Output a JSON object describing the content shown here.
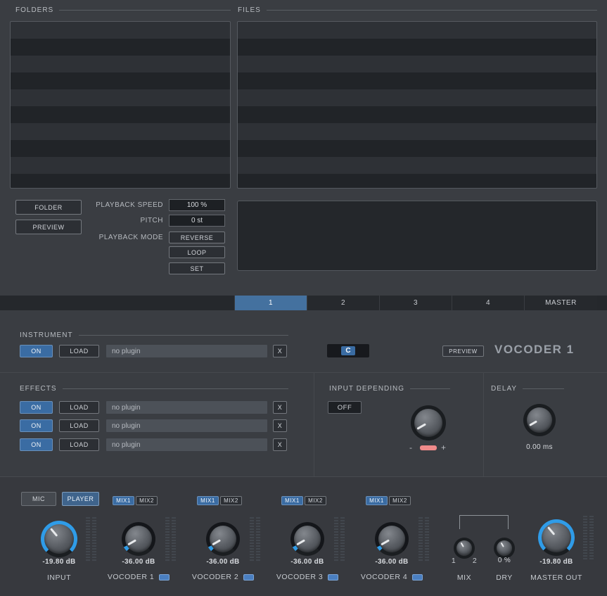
{
  "browser": {
    "folders_label": "FOLDERS",
    "files_label": "FILES",
    "folder_button": "FOLDER",
    "preview_button": "PREVIEW",
    "playback_speed_label": "PLAYBACK SPEED",
    "playback_speed_value": "100 %",
    "pitch_label": "PITCH",
    "pitch_value": "0 st",
    "playback_mode_label": "PLAYBACK MODE",
    "reverse_button": "REVERSE",
    "loop_button": "LOOP",
    "set_button": "SET"
  },
  "tabs": {
    "tab1": "1",
    "tab2": "2",
    "tab3": "3",
    "tab4": "4",
    "master": "MASTER"
  },
  "instrument": {
    "section_label": "INSTRUMENT",
    "on": "ON",
    "load": "LOAD",
    "plugin": "no plugin",
    "clear": "X",
    "note": "C",
    "preview": "PREVIEW",
    "title": "VOCODER 1"
  },
  "effects": {
    "section_label": "EFFECTS",
    "rows": [
      {
        "on": "ON",
        "load": "LOAD",
        "plugin": "no plugin",
        "clear": "X"
      },
      {
        "on": "ON",
        "load": "LOAD",
        "plugin": "no plugin",
        "clear": "X"
      },
      {
        "on": "ON",
        "load": "LOAD",
        "plugin": "no plugin",
        "clear": "X"
      }
    ]
  },
  "input_depending": {
    "section_label": "INPUT DEPENDING",
    "off": "OFF",
    "minus": "-",
    "plus": "+"
  },
  "delay": {
    "section_label": "DELAY",
    "value": "0.00 ms"
  },
  "mixer": {
    "mic": "MIC",
    "player": "PLAYER",
    "mix1": "MIX1",
    "mix2": "MIX2",
    "input": {
      "value": "-19.80 dB",
      "label": "INPUT"
    },
    "vocoder1": {
      "value": "-36.00 dB",
      "label": "VOCODER 1"
    },
    "vocoder2": {
      "value": "-36.00 dB",
      "label": "VOCODER 2"
    },
    "vocoder3": {
      "value": "-36.00 dB",
      "label": "VOCODER 3"
    },
    "vocoder4": {
      "value": "-36.00 dB",
      "label": "VOCODER 4"
    },
    "mix": {
      "left": "1",
      "right": "2",
      "label": "MIX"
    },
    "dry": {
      "value": "0 %",
      "label": "DRY"
    },
    "master": {
      "value": "-19.80 dB",
      "label": "MASTER OUT"
    }
  },
  "colors": {
    "accent": "#3a6ca3",
    "knob_arc": "#2f9ce8",
    "led": "#4a7fc1",
    "slider": "#ef8a8a"
  }
}
